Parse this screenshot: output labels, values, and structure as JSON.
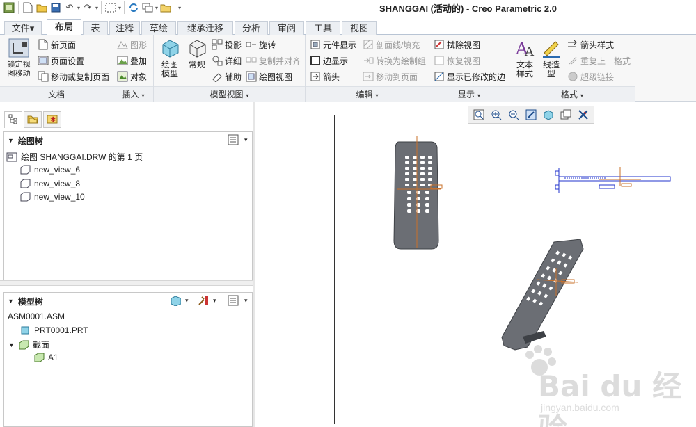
{
  "window": {
    "title": "SHANGGAI (活动的) - Creo Parametric 2.0"
  },
  "tabs": [
    "文件▾",
    "布局",
    "表",
    "注释",
    "草绘",
    "继承迁移",
    "分析",
    "审阅",
    "工具",
    "视图"
  ],
  "ribbon": {
    "document": {
      "label": "文档",
      "lock_view_move": "锁定视\n图移动",
      "new_page": "新页面",
      "page_setup": "页面设置",
      "move_copy_page": "移动或复制页面"
    },
    "insert": {
      "label": "插入",
      "graphics": "图形",
      "overlay": "叠加",
      "object": "对象"
    },
    "model_views": {
      "label": "模型视图",
      "drawing_model": "绘图\n模型",
      "general": "常规",
      "projection": "投影",
      "detail": "详细",
      "auxiliary": "辅助",
      "revolve": "旋转",
      "copy_align": "复制并对齐",
      "drawing_view": "绘图视图"
    },
    "edit": {
      "label": "编辑",
      "component_display": "元件显示",
      "edge_display": "边显示",
      "arrow": "箭头",
      "section_fill": "剖面线/填充",
      "convert_to_draw_group": "转换为绘制组",
      "move_to_page": "移动到页面"
    },
    "display": {
      "label": "显示",
      "erase_view": "拭除视图",
      "resume_view": "恢复视图",
      "show_modified_edges": "显示已修改的边"
    },
    "format": {
      "label": "格式",
      "text_style": "文本\n样式",
      "line_style": "线造\n型",
      "arrow_style": "箭头样式",
      "repeat_last_format": "重复上一格式",
      "hyperlink": "超级链接"
    }
  },
  "drawing_tree": {
    "title": "绘图树",
    "root": "绘图 SHANGGAI.DRW 的第 1 页",
    "views": [
      "new_view_6",
      "new_view_8",
      "new_view_10"
    ]
  },
  "model_tree": {
    "title": "模型树",
    "root": "ASM0001.ASM",
    "part": "PRT0001.PRT",
    "section_folder": "截面",
    "section": "A1"
  },
  "watermark": {
    "brand": "Bai du 经验",
    "url": "jingyan.baidu.com"
  },
  "colors": {
    "remote_body": "#6b6e74",
    "remote_dark": "#4a4d52",
    "axis_orange": "#c8702a",
    "view_blue": "#2233cc",
    "accent_tab_border": "#b8c4d4"
  }
}
